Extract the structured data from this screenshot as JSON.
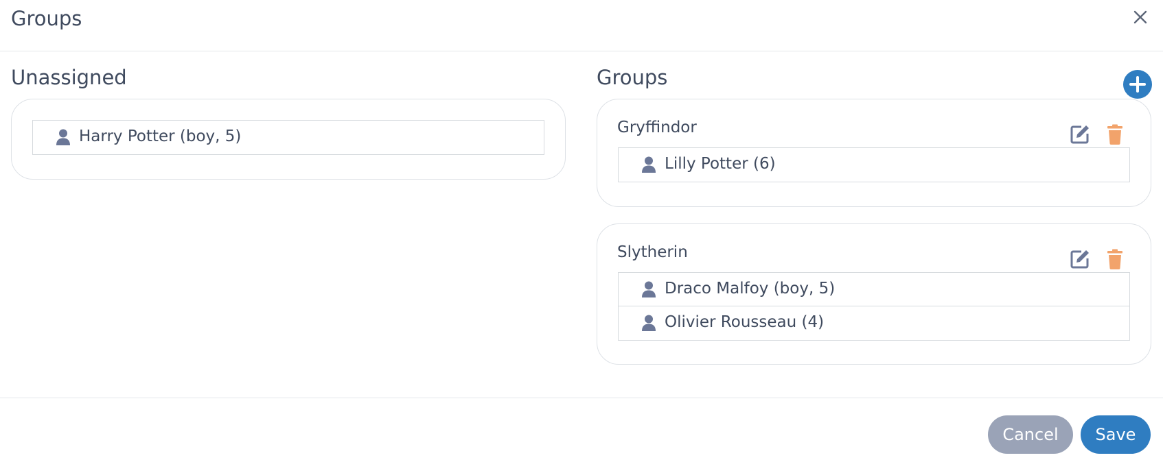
{
  "dialog": {
    "title": "Groups"
  },
  "unassigned": {
    "title": "Unassigned",
    "members": [
      "Harry Potter (boy, 5)"
    ]
  },
  "groups_section": {
    "title": "Groups",
    "groups": [
      {
        "name": "Gryffindor",
        "members": [
          "Lilly Potter (6)"
        ]
      },
      {
        "name": "Slytherin",
        "members": [
          "Draco Malfoy (boy, 5)",
          "Olivier Rousseau (4)"
        ]
      }
    ]
  },
  "footer": {
    "cancel_label": "Cancel",
    "save_label": "Save"
  },
  "icons": {
    "person": "person-icon",
    "edit": "edit-icon",
    "delete": "trash-icon",
    "add": "plus-icon",
    "close": "close-icon"
  },
  "colors": {
    "primary": "#2f7dc1",
    "secondary": "#9aa3b7",
    "delete": "#f2a36b",
    "icon": "#6b7797",
    "text": "#3f4a5e"
  }
}
